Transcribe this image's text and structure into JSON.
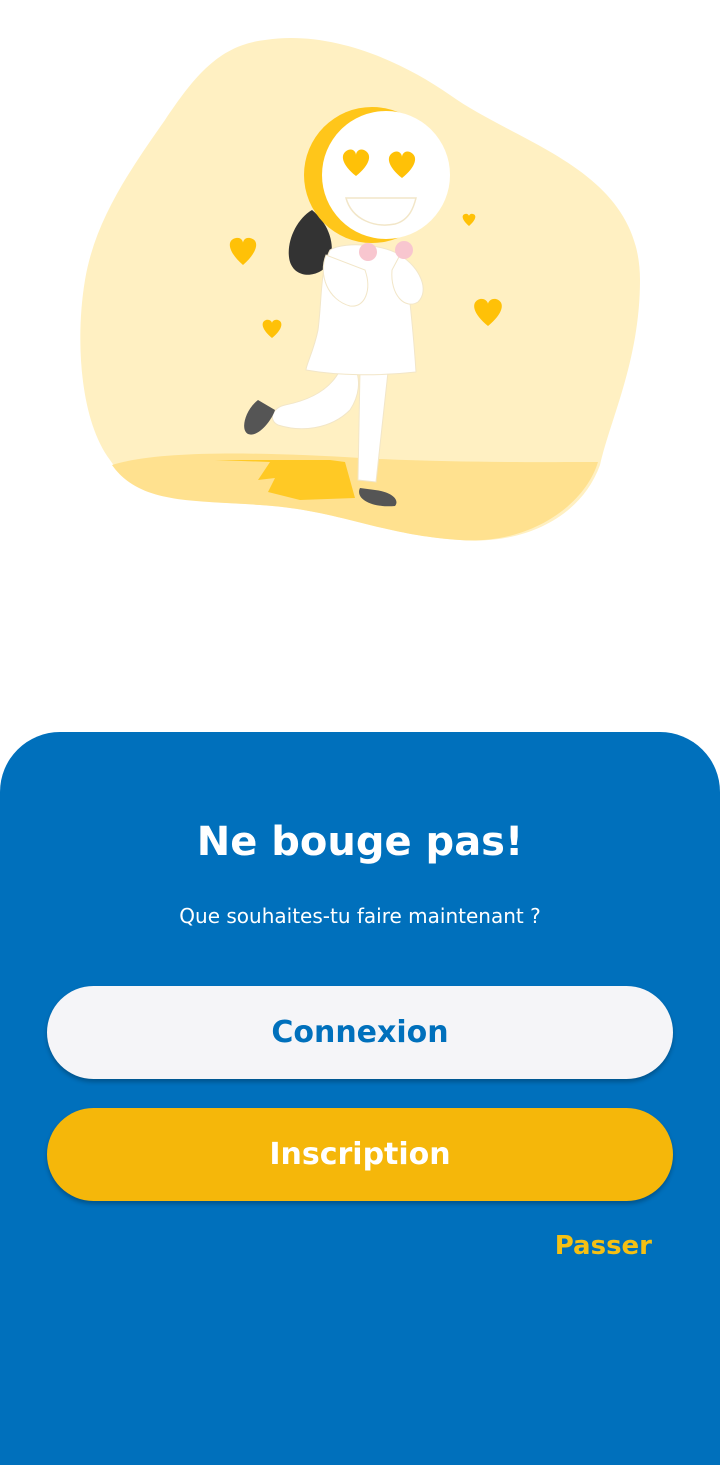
{
  "colors": {
    "panel_background": "#0070bc",
    "primary_button_background": "#f5f5f8",
    "primary_button_text": "#0070bc",
    "secondary_button_background": "#f5b70a",
    "secondary_button_text": "#ffffff",
    "skip_link_text": "#f5c013",
    "illustration_blob": "#fff0c2",
    "illustration_accent": "#ffc61a"
  },
  "illustration": {
    "icon": "girl-with-heart-eyes-emoji-mask-illustration"
  },
  "welcome": {
    "title": "Ne bouge pas!",
    "subtitle": "Que souhaites-tu faire maintenant ?"
  },
  "actions": {
    "login_label": "Connexion",
    "signup_label": "Inscription",
    "skip_label": "Passer"
  }
}
